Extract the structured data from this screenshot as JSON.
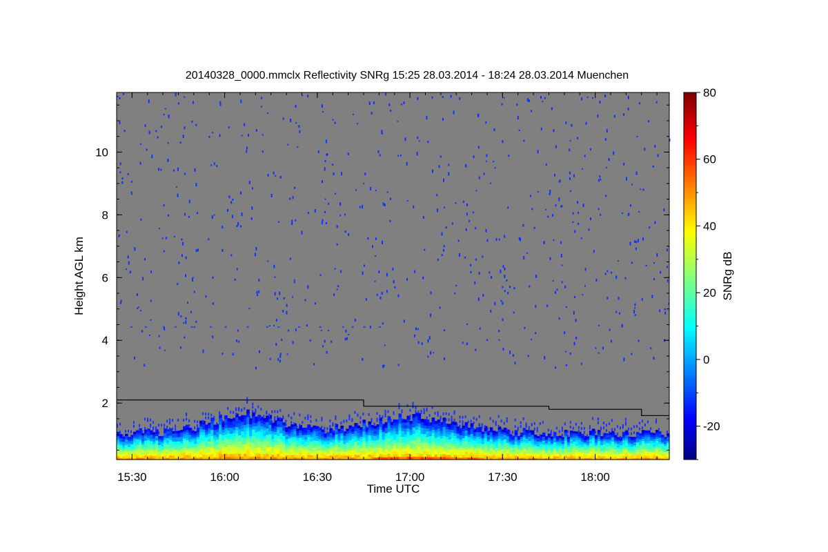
{
  "chart_data": {
    "type": "heatmap",
    "title": "20140328_0000.mmclx Reflectivity SNRg   15:25 28.03.2014 - 18:24 28.03.2014 Muenchen",
    "xlabel": "Time UTC",
    "ylabel": "Height AGL km",
    "colorbar_label": "SNRg dB",
    "x_range_hours": [
      15.4167,
      18.4
    ],
    "y_range_km": [
      0.2,
      11.9
    ],
    "color_range_db": [
      -30,
      80
    ],
    "x_ticks": [
      {
        "value": 15.5,
        "label": "15:30"
      },
      {
        "value": 16.0,
        "label": "16:00"
      },
      {
        "value": 16.5,
        "label": "16:30"
      },
      {
        "value": 17.0,
        "label": "17:00"
      },
      {
        "value": 17.5,
        "label": "17:30"
      },
      {
        "value": 18.0,
        "label": "18:00"
      }
    ],
    "y_ticks": [
      {
        "value": 2,
        "label": "2"
      },
      {
        "value": 4,
        "label": "4"
      },
      {
        "value": 6,
        "label": "6"
      },
      {
        "value": 8,
        "label": "8"
      },
      {
        "value": 10,
        "label": "10"
      }
    ],
    "colorbar_ticks": [
      {
        "value": -20,
        "label": "-20"
      },
      {
        "value": 0,
        "label": "0"
      },
      {
        "value": 20,
        "label": "20"
      },
      {
        "value": 40,
        "label": "40"
      },
      {
        "value": 60,
        "label": "60"
      },
      {
        "value": 80,
        "label": "80"
      }
    ],
    "colors": {
      "background_field": "#808080",
      "boundary_line": "#000000"
    },
    "boundary_layer_height_km": {
      "x_hours": [
        15.4167,
        16.75,
        16.75,
        17.75,
        17.75,
        18.25,
        18.25,
        18.4
      ],
      "y_km": [
        2.1,
        2.1,
        1.9,
        1.9,
        1.8,
        1.8,
        1.6,
        1.6
      ]
    }
  }
}
